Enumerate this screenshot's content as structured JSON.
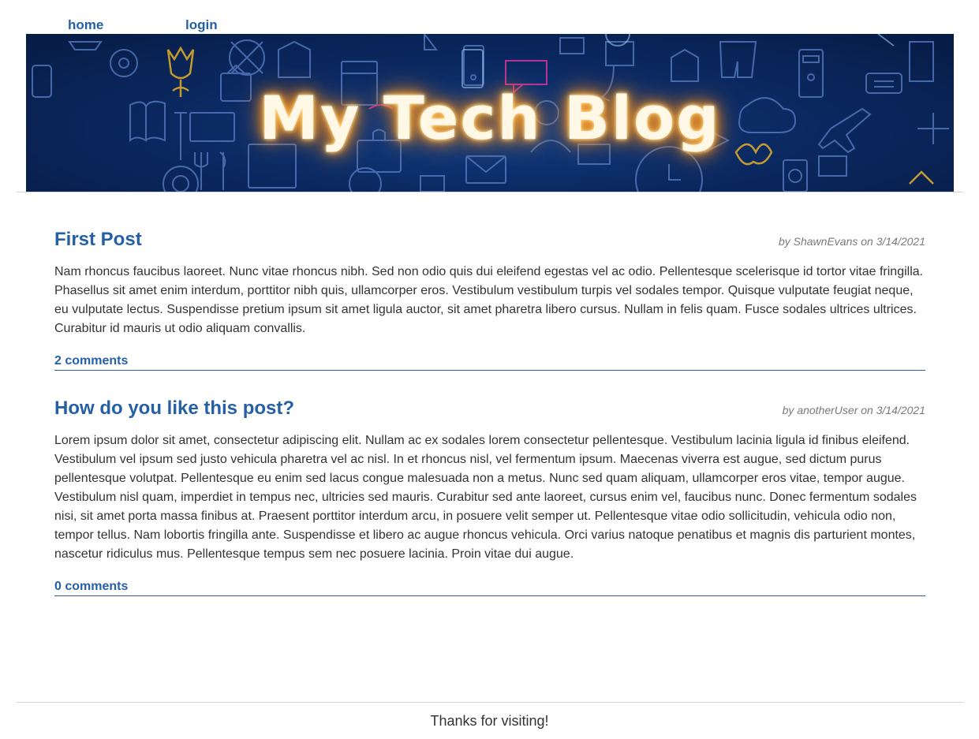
{
  "nav": {
    "home_label": "home",
    "login_label": "login"
  },
  "header": {
    "banner_title": "My Tech Blog"
  },
  "posts": [
    {
      "title": "First Post",
      "meta": "by ShawnEvans on 3/14/2021",
      "body": "Nam rhoncus faucibus laoreet. Nunc vitae rhoncus nibh. Sed non odio quis dui eleifend egestas vel ac odio. Pellentesque scelerisque id tortor vitae fringilla. Phasellus sit amet enim interdum, porttitor nibh quis, ullamcorper eros. Vestibulum vestibulum turpis vel sodales tempor. Quisque vulputate feugiat neque, eu vulputate lectus. Suspendisse pretium ipsum sit amet ligula auctor, sit amet pharetra libero cursus. Nullam in felis quam. Fusce sodales ultrices ultrices. Curabitur id mauris ut odio aliquam convallis.",
      "comments": "2 comments"
    },
    {
      "title": "How do you like this post?",
      "meta": "by anotherUser on 3/14/2021",
      "body": "Lorem ipsum dolor sit amet, consectetur adipiscing elit. Nullam ac ex sodales lorem consectetur pellentesque. Vestibulum lacinia ligula id finibus eleifend. Vestibulum vel ipsum sed justo vehicula pharetra vel ac nisl. In et rhoncus nisl, vel fermentum ipsum. Maecenas viverra est augue, sed dictum purus pellentesque volutpat. Pellentesque eu enim sed lacus congue malesuada non a metus. Nunc sed quam aliquam, ullamcorper eros vitae, tempor augue. Vestibulum nisl quam, imperdiet in tempus nec, ultricies sed mauris. Curabitur sed ante laoreet, cursus enim vel, faucibus nunc. Donec fermentum sodales nisi, sit amet porta massa finibus at. Praesent porttitor interdum arcu, in posuere velit semper ut. Pellentesque vitae odio sollicitudin, vehicula odio non, tempor tellus. Nam lobortis fringilla ante. Suspendisse et libero ac augue rhoncus vehicula. Orci varius natoque penatibus et magnis dis parturient montes, nascetur ridiculus mus. Pellentesque tempus sem nec posuere lacinia. Proin vitae dui augue.",
      "comments": "0 comments"
    }
  ],
  "footer": {
    "text": "Thanks for visiting!"
  },
  "colors": {
    "link": "#2660a4",
    "banner_bg": "#0b2a63",
    "title_glow": "#ff9a1f"
  }
}
